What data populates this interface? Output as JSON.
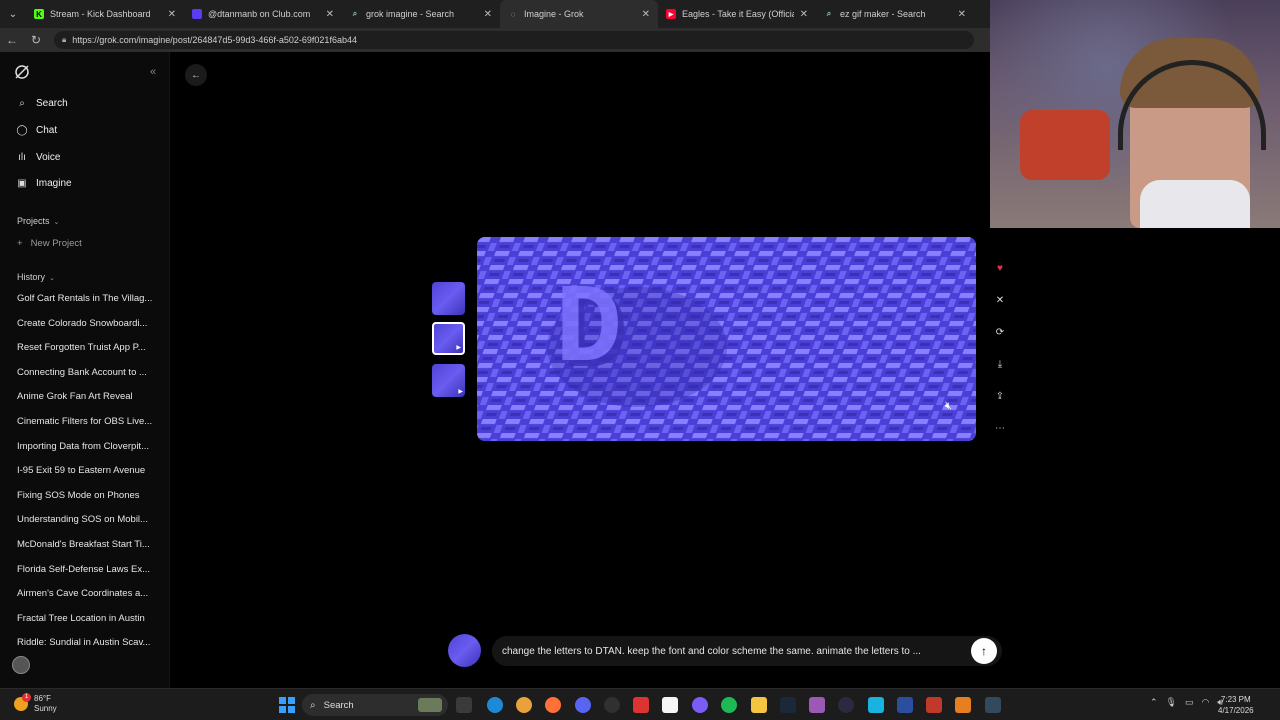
{
  "browser": {
    "tabs": [
      {
        "title": "Stream - Kick Dashboard",
        "fav_color": "#53fc18",
        "fav_glyph": "K"
      },
      {
        "title": "@dtanmanb on Club.com",
        "fav_color": "#5b3cf5",
        "fav_glyph": ""
      },
      {
        "title": "grok imagine - Search",
        "fav_color": "#1e1e1e",
        "fav_glyph": "Q"
      },
      {
        "title": "Imagine - Grok",
        "fav_color": "#1e1e1e",
        "fav_glyph": "◌"
      },
      {
        "title": "Eagles - Take it Easy (Official Audi",
        "fav_color": "#ff0033",
        "fav_glyph": "▶"
      },
      {
        "title": "ez gif maker - Search",
        "fav_color": "#1e1e1e",
        "fav_glyph": "Q"
      }
    ],
    "url": "https://grok.com/imagine/post/264847d5-99d3-466f-a502-69f021f6ab44"
  },
  "sidebar": {
    "nav": [
      {
        "label": "Search",
        "icon": "search-icon"
      },
      {
        "label": "Chat",
        "icon": "chat-icon"
      },
      {
        "label": "Voice",
        "icon": "voice-icon"
      },
      {
        "label": "Imagine",
        "icon": "image-icon"
      }
    ],
    "projects_label": "Projects",
    "new_project_label": "New Project",
    "history_label": "History",
    "history": [
      "Golf Cart Rentals in The Villag...",
      "Create Colorado Snowboardi...",
      "Reset Forgotten Truist App P...",
      "Connecting Bank Account to ...",
      "Anime Grok Fan Art Reveal",
      "Cinematic Filters for OBS Live...",
      "Importing Data from Cloverpit...",
      "I-95 Exit 59 to Eastern Avenue",
      "Fixing SOS Mode on Phones",
      "Understanding SOS on Mobil...",
      "McDonald's Breakfast Start Ti...",
      "Florida Self-Defense Laws Ex...",
      "Airmen's Cave Coordinates a...",
      "Fractal Tree Location in Austin",
      "Riddle: Sundial in Austin Scav..."
    ]
  },
  "viewer": {
    "letter": "D",
    "prompt": "change the letters to DTAN. keep the font and color scheme the same. animate the letters to ..."
  },
  "taskbar": {
    "temp": "86°F",
    "condition": "Sunny",
    "badge": "1",
    "search_label": "Search",
    "time": "7:23 PM",
    "date": "4/17/2026"
  }
}
